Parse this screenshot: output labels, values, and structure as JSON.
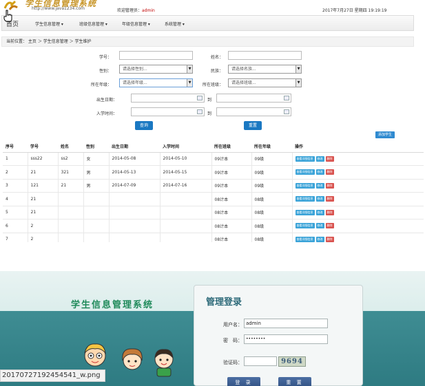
{
  "header": {
    "logo_text": "学生信息管理系统",
    "logo_url": "http://www.java1234.com",
    "welcome_prefix": "欢迎管理员：",
    "admin_user": "admin",
    "datetime": "2017年7月27日 星期四 19:19:19"
  },
  "nav": {
    "home": "首页",
    "items": [
      "学生信息管理 ▾",
      "班级信息管理 ▾",
      "年级信息管理 ▾",
      "系统管理 ▾"
    ]
  },
  "breadcrumb": "当前位置： 主页 ＞ 学生信息管理 ＞ 学生维护",
  "search": {
    "stu_no_label": "学号：",
    "name_label": "姓名：",
    "gender_label": "性别：",
    "gender_placeholder": "请选择性别...",
    "nation_label": "民族：",
    "nation_placeholder": "请选择名族...",
    "grade_label": "所在年级：",
    "grade_placeholder": "请选择年级...",
    "class_label": "所在班级：",
    "class_placeholder": "请选择班级...",
    "birth_label": "出生日期：",
    "to_label": "到",
    "enroll_label": "入学时间：",
    "query_button": "查询",
    "reset_button": "重置",
    "add_button": "添加学生"
  },
  "table": {
    "headers": [
      "序号",
      "学号",
      "姓名",
      "性别",
      "出生日期",
      "入学时间",
      "所在班级",
      "所在年级",
      "操作"
    ],
    "rows": [
      [
        "1",
        "sss22",
        "ss2",
        "女",
        "2014-05-08",
        "2014-05-10",
        "09计本",
        "09级"
      ],
      [
        "2",
        "21",
        "321",
        "男",
        "2014-05-13",
        "2014-05-15",
        "09计本",
        "09级"
      ],
      [
        "3",
        "121",
        "21",
        "男",
        "2014-07-09",
        "2014-07-16",
        "09计本",
        "09级"
      ],
      [
        "4",
        "21",
        "",
        "",
        "",
        "",
        "08计本",
        "08级"
      ],
      [
        "5",
        "21",
        "",
        "",
        "",
        "",
        "08计本",
        "08级"
      ],
      [
        "6",
        "2",
        "",
        "",
        "",
        "",
        "08计本",
        "08级"
      ],
      [
        "7",
        "2",
        "",
        "",
        "",
        "",
        "08计本",
        "08级"
      ]
    ],
    "action_labels": {
      "detail": "查看详细信息",
      "edit": "修改",
      "delete": "删除"
    }
  },
  "login": {
    "system_title": "学生信息管理系统",
    "panel_title": "管理登录",
    "username_label": "用户名：",
    "username_value": "admin",
    "password_label": "密　码：",
    "password_value": "••••••••",
    "captcha_label": "验证码：",
    "captcha_value": "9694",
    "login_button": "登 录",
    "reset_button": "重 置"
  },
  "filename": "20170727192454541_w.png"
}
